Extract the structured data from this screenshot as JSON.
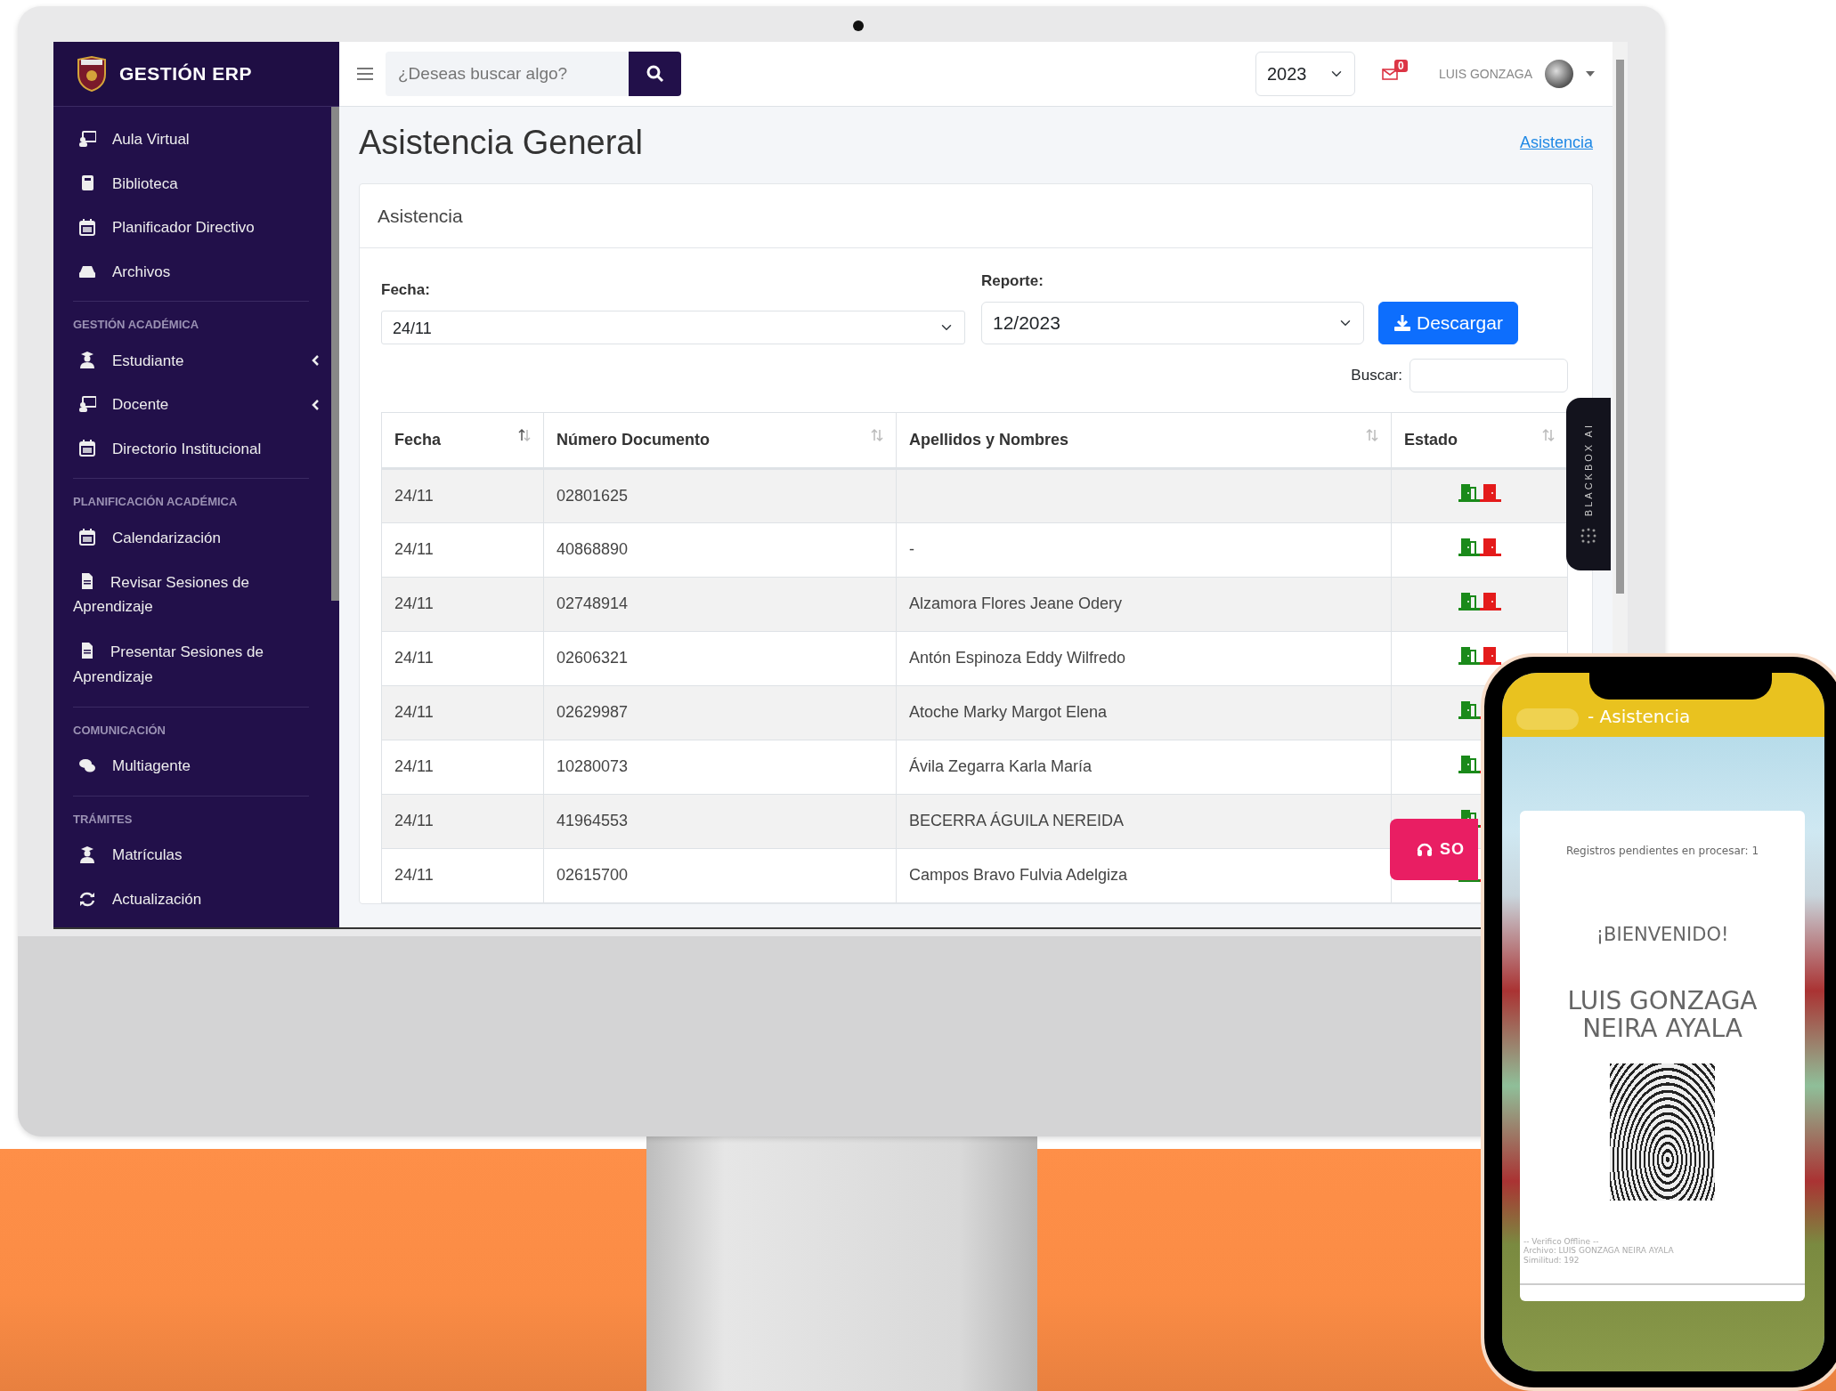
{
  "brand": "GESTIÓN ERP",
  "sidebar": {
    "sections": [
      {
        "items": [
          {
            "label": "Aula Virtual",
            "kind": "board",
            "submenu": false
          },
          {
            "label": "Biblioteca",
            "kind": "book",
            "submenu": false
          },
          {
            "label": "Planificador Directivo",
            "kind": "calendar",
            "submenu": false
          },
          {
            "label": "Archivos",
            "kind": "drive",
            "submenu": false
          }
        ]
      },
      {
        "heading": "GESTIÓN ACADÉMICA",
        "items": [
          {
            "label": "Estudiante",
            "kind": "student",
            "submenu": true
          },
          {
            "label": "Docente",
            "kind": "board",
            "submenu": true
          },
          {
            "label": "Directorio Institucional",
            "kind": "calendar",
            "submenu": false
          }
        ]
      },
      {
        "heading": "PLANIFICACIÓN ACADÉMICA",
        "items": [
          {
            "label": "Calendarización",
            "kind": "calendar",
            "submenu": false
          },
          {
            "label": "Revisar Sesiones de Aprendizaje",
            "kind": "file",
            "submenu": false
          },
          {
            "label": "Presentar Sesiones de Aprendizaje",
            "kind": "file",
            "submenu": false
          }
        ]
      },
      {
        "heading": "COMUNICACIÓN",
        "items": [
          {
            "label": "Multiagente",
            "kind": "chat",
            "submenu": false
          }
        ]
      },
      {
        "heading": "TRÁMITES",
        "items": [
          {
            "label": "Matrículas",
            "kind": "student",
            "submenu": false
          },
          {
            "label": "Actualización",
            "kind": "sync",
            "submenu": false
          }
        ]
      }
    ]
  },
  "topbar": {
    "search_placeholder": "¿Deseas buscar algo?",
    "year": "2023",
    "mail_count": "0",
    "user": "LUIS GONZAGA"
  },
  "page": {
    "title": "Asistencia General",
    "breadcrumb": "Asistencia"
  },
  "card": {
    "title": "Asistencia",
    "fecha_label": "Fecha:",
    "fecha_value": "24/11",
    "reporte_label": "Reporte:",
    "reporte_value": "12/2023",
    "download_button": "Descargar",
    "search_label": "Buscar:"
  },
  "table": {
    "columns": [
      "Fecha",
      "Número Documento",
      "Apellidos y Nombres",
      "Estado"
    ],
    "rows": [
      {
        "fecha": "24/11",
        "documento": "02801625"
      },
      {
        "fecha": "24/11",
        "documento": "40868890",
        "nombre": "-"
      },
      {
        "fecha": "24/11",
        "documento": "02748914",
        "nombre": "Alzamora Flores Jeane Odery"
      },
      {
        "fecha": "24/11",
        "documento": "02606321",
        "nombre": "Antón Espinoza Eddy Wilfredo"
      },
      {
        "fecha": "24/11",
        "documento": "02629987",
        "nombre": "Atoche Marky Margot Elena"
      },
      {
        "fecha": "24/11",
        "documento": "10280073",
        "nombre": "Ávila Zegarra Karla María"
      },
      {
        "fecha": "24/11",
        "documento": "41964553",
        "nombre": "BECERRA ÁGUILA NEREIDA"
      },
      {
        "fecha": "24/11",
        "documento": "02615700",
        "nombre": "Campos Bravo Fulvia Adelgiza"
      }
    ]
  },
  "blackbox_tab": {
    "label": "BLACKBOX AI"
  },
  "support_button": {
    "label": "SO"
  },
  "phone": {
    "header": "- Asistencia",
    "pending": "Registros pendientes en procesar: 1",
    "welcome": "¡BIENVENIDO!",
    "name": "LUIS GONZAGA NEIRA AYALA",
    "footer": [
      "-- Verifico Offline --",
      "Archivo: LUIS GONZAGA NEIRA AYALA",
      "Similitud: 192"
    ]
  }
}
